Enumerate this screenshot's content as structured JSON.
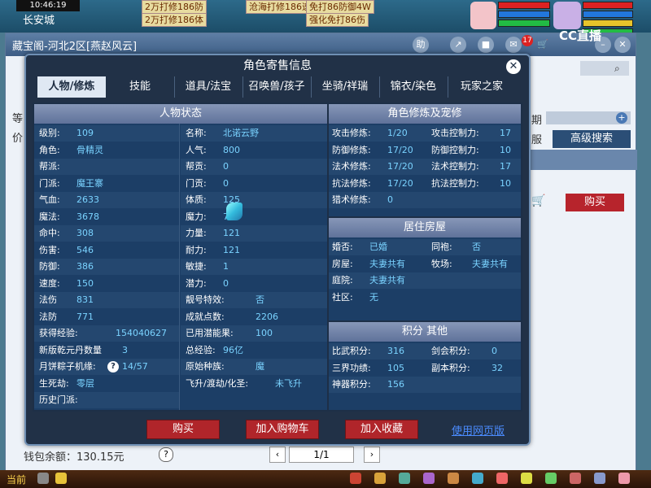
{
  "game": {
    "time": "10:46:19",
    "location": "长安城",
    "chat_messages": [
      "2万打修186防",
      "2万打修186体",
      "沧海打修186速",
      "免打86防御4W",
      "强化免打86伤"
    ],
    "count_badge": "17"
  },
  "shop": {
    "title": "藏宝阁-河北2区[燕赵风云]",
    "brand": "CC直播",
    "label_deng": "等",
    "label_jia": "价",
    "label_qi": "期",
    "label_fu": "服",
    "advanced_search": "高级搜索",
    "buy": "购买",
    "wallet": "钱包余额：130.15元",
    "page": "1/1"
  },
  "taskbar": {
    "label": "当前"
  },
  "dialog": {
    "title": "角色寄售信息",
    "tabs": [
      "人物/修炼",
      "技能",
      "道具/法宝",
      "召唤兽/孩子",
      "坐骑/祥瑞",
      "锦衣/染色",
      "玩家之家"
    ],
    "active_tab": 0,
    "status": {
      "header": "人物状态",
      "left": [
        {
          "label": "级别:",
          "value": "109"
        },
        {
          "label": "角色:",
          "value": "骨精灵"
        },
        {
          "label": "帮派:",
          "value": ""
        },
        {
          "label": "门派:",
          "value": "魔王寨"
        },
        {
          "label": "气血:",
          "value": "2633"
        },
        {
          "label": "魔法:",
          "value": "3678"
        },
        {
          "label": "命中:",
          "value": "308"
        },
        {
          "label": "伤害:",
          "value": "546"
        },
        {
          "label": "防御:",
          "value": "386"
        },
        {
          "label": "速度:",
          "value": "150"
        },
        {
          "label": "法伤",
          "value": "831"
        },
        {
          "label": "法防",
          "value": "771"
        },
        {
          "label": "获得经验:",
          "value": "154040627"
        },
        {
          "label": "新版乾元丹数量",
          "value": "3"
        },
        {
          "label": "月饼粽子机缘:",
          "value": "14/57"
        },
        {
          "label": "生死劫:",
          "value": "零层"
        },
        {
          "label": "历史门派:",
          "value": ""
        }
      ],
      "right": [
        {
          "label": "名称:",
          "value": "北诺云野"
        },
        {
          "label": "人气:",
          "value": "800"
        },
        {
          "label": "帮贡:",
          "value": "0"
        },
        {
          "label": "门贡:",
          "value": "0"
        },
        {
          "label": "体质:",
          "value": "125"
        },
        {
          "label": "魔力:",
          "value": "772"
        },
        {
          "label": "力量:",
          "value": "121"
        },
        {
          "label": "耐力:",
          "value": "121"
        },
        {
          "label": "敏捷:",
          "value": "1"
        },
        {
          "label": "潜力:",
          "value": "0"
        },
        {
          "label": "靓号特效:",
          "value": "否"
        },
        {
          "label": "成就点数:",
          "value": "2206"
        },
        {
          "label": "已用潜能果:",
          "value": "100"
        },
        {
          "label": "总经验:",
          "value": "96亿"
        },
        {
          "label": "原始种族:",
          "value": "魔"
        },
        {
          "label": "飞升/渡劫/化圣:",
          "value": "未飞升"
        }
      ]
    },
    "cultivation": {
      "header": "角色修炼及宠修",
      "rows": [
        {
          "l1": "攻击修炼:",
          "v1": "1/20",
          "l2": "攻击控制力:",
          "v2": "17"
        },
        {
          "l1": "防御修炼:",
          "v1": "17/20",
          "l2": "防御控制力:",
          "v2": "10"
        },
        {
          "l1": "法术修炼:",
          "v1": "17/20",
          "l2": "法术控制力:",
          "v2": "17"
        },
        {
          "l1": "抗法修炼:",
          "v1": "17/20",
          "l2": "抗法控制力:",
          "v2": "10"
        },
        {
          "l1": "猎术修炼:",
          "v1": "0",
          "l2": "",
          "v2": ""
        }
      ]
    },
    "housing": {
      "header": "居住房屋",
      "rows": [
        {
          "l1": "婚否:",
          "v1": "已婚",
          "l2": "同袍:",
          "v2": "否"
        },
        {
          "l1": "房屋:",
          "v1": "夫妻共有",
          "l2": "牧场:",
          "v2": "夫妻共有"
        },
        {
          "l1": "庭院:",
          "v1": "夫妻共有",
          "l2": "",
          "v2": ""
        },
        {
          "l1": "社区:",
          "v1": "无",
          "l2": "",
          "v2": ""
        }
      ]
    },
    "points": {
      "header": "积分 其他",
      "rows": [
        {
          "l1": "比武积分:",
          "v1": "316",
          "l2": "剑会积分:",
          "v2": "0"
        },
        {
          "l1": "三界功绩:",
          "v1": "105",
          "l2": "副本积分:",
          "v2": "32"
        },
        {
          "l1": "神器积分:",
          "v1": "156",
          "l2": "",
          "v2": ""
        }
      ]
    },
    "buttons": {
      "buy": "购买",
      "add_cart": "加入购物车",
      "add_fav": "加入收藏",
      "web_version": "使用网页版"
    }
  }
}
